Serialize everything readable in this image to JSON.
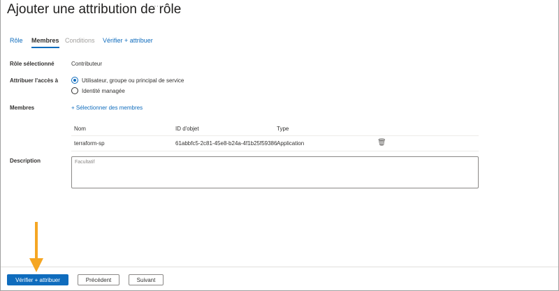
{
  "header": {
    "title": "Ajouter une attribution de rôle",
    "more": "···"
  },
  "tabs": [
    {
      "label": "Rôle"
    },
    {
      "label": "Membres"
    },
    {
      "label": "Conditions"
    },
    {
      "label": "Vérifier + attribuer"
    }
  ],
  "form": {
    "role_label": "Rôle sélectionné",
    "role_value": "Contributeur",
    "access_label": "Attribuer l'accès à",
    "access_options": [
      {
        "label": "Utilisateur, groupe ou principal de service",
        "checked": true
      },
      {
        "label": "Identité managée",
        "checked": false
      }
    ],
    "members_label": "Membres",
    "select_members": "Sélectionner des membres",
    "description_label": "Description",
    "description_placeholder": "Facultatif",
    "description_value": ""
  },
  "table": {
    "headers": [
      "Nom",
      "ID d'objet",
      "Type"
    ],
    "rows": [
      {
        "name": "terraform-sp",
        "id": "61abbfc5-2c81-45e8-b24a-4f1b25f59386",
        "type": "Application"
      }
    ]
  },
  "footer": {
    "primary": "Vérifier + attribuer",
    "previous": "Précédent",
    "next": "Suivant"
  },
  "colors": {
    "accent": "#0f6cbd",
    "arrow": "#f5a623"
  }
}
